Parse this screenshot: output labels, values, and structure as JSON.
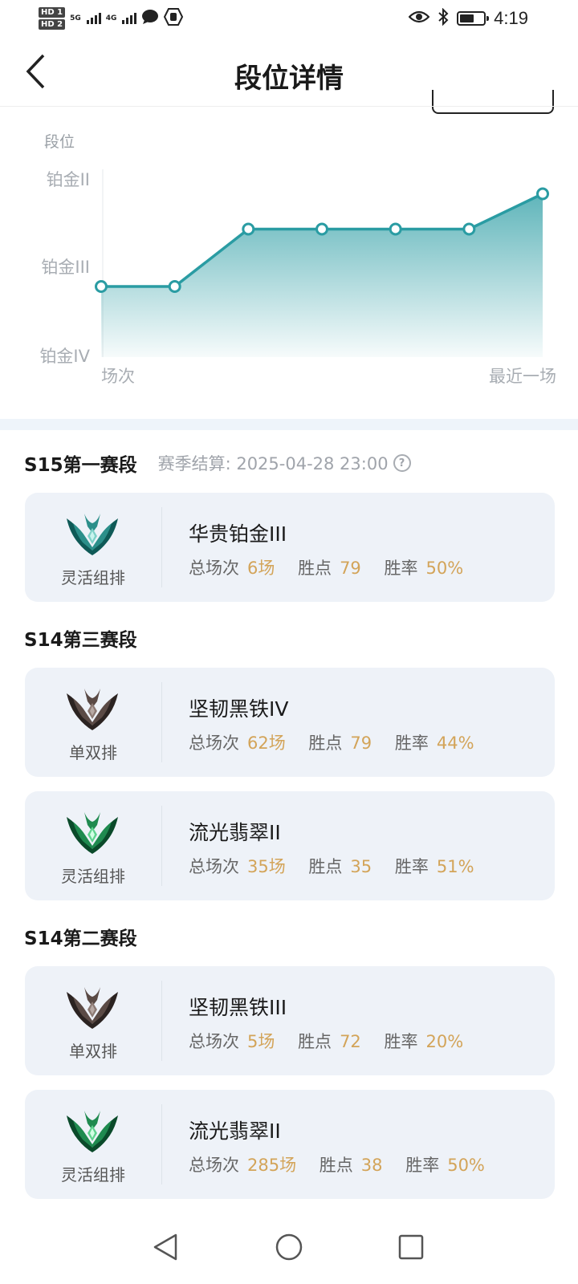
{
  "status_bar": {
    "hd1": "HD 1",
    "hd2": "HD 2",
    "net1": "5G",
    "net2": "4G",
    "time": "4:19",
    "battery_level": 0.6
  },
  "header": {
    "title": "段位详情"
  },
  "chart_data": {
    "type": "area",
    "ylabel": "段位",
    "y_ticks": [
      "铂金IV",
      "铂金III",
      "铂金II"
    ],
    "x_start_label": "场次",
    "x_end_label": "最近一场",
    "ylim": [
      0,
      2
    ],
    "values": [
      0.8,
      0.8,
      1.45,
      1.45,
      1.45,
      1.45,
      1.85
    ],
    "line_color": "#2a9ca3"
  },
  "seasons": [
    {
      "title": "S15第一赛段",
      "settle_label": "赛季结算: 2025-04-28 23:00",
      "help": "?",
      "cards": [
        {
          "emblem": "platinum-emblem",
          "queue": "灵活组排",
          "rank": "华贵铂金III",
          "games_label": "总场次",
          "games": "6场",
          "points_label": "胜点",
          "points": "79",
          "winrate_label": "胜率",
          "winrate": "50%"
        }
      ]
    },
    {
      "title": "S14第三赛段",
      "cards": [
        {
          "emblem": "iron-emblem",
          "queue": "单双排",
          "rank": "坚韧黑铁IV",
          "games_label": "总场次",
          "games": "62场",
          "points_label": "胜点",
          "points": "79",
          "winrate_label": "胜率",
          "winrate": "44%"
        },
        {
          "emblem": "emerald-emblem",
          "queue": "灵活组排",
          "rank": "流光翡翠II",
          "games_label": "总场次",
          "games": "35场",
          "points_label": "胜点",
          "points": "35",
          "winrate_label": "胜率",
          "winrate": "51%"
        }
      ]
    },
    {
      "title": "S14第二赛段",
      "cards": [
        {
          "emblem": "iron-emblem",
          "queue": "单双排",
          "rank": "坚韧黑铁III",
          "games_label": "总场次",
          "games": "5场",
          "points_label": "胜点",
          "points": "72",
          "winrate_label": "胜率",
          "winrate": "20%"
        },
        {
          "emblem": "emerald-emblem",
          "queue": "灵活组排",
          "rank": "流光翡翠II",
          "games_label": "总场次",
          "games": "285场",
          "points_label": "胜点",
          "points": "38",
          "winrate_label": "胜率",
          "winrate": "50%"
        }
      ]
    }
  ],
  "colors": {
    "accent": "#2a9ca3",
    "stat_value": "#d3a459",
    "card_bg": "#eef2f8",
    "separator": "#eef4fa"
  }
}
